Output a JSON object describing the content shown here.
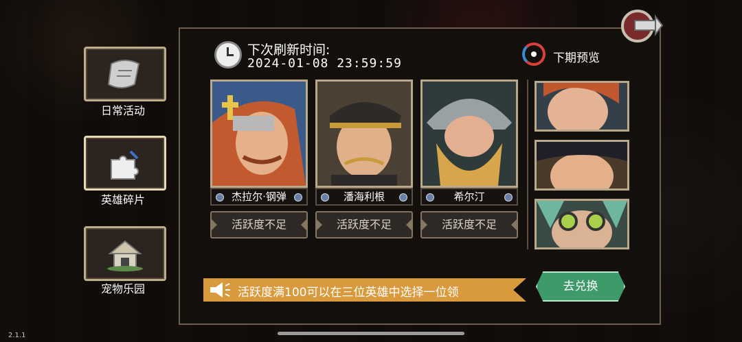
{
  "version": "2.1.1",
  "menu": [
    {
      "label": "日常活动",
      "icon": "scroll-icon"
    },
    {
      "label": "英雄碎片",
      "icon": "puzzle-piece-icon"
    },
    {
      "label": "宠物乐园",
      "icon": "pet-house-icon"
    }
  ],
  "refresh": {
    "label": "下次刷新时间:",
    "time": "2024-01-08 23:59:59"
  },
  "preview_label": "下期预览",
  "heroes": [
    {
      "name": "杰拉尔·钢弹",
      "button": "活跃度不足",
      "hair": "#c35a2f"
    },
    {
      "name": "潘海利根",
      "button": "活跃度不足",
      "hair": "#c99a3a"
    },
    {
      "name": "希尔汀",
      "button": "活跃度不足",
      "hair": "#d8a64a"
    }
  ],
  "notice": "活跃度满100可以在三位英雄中选择一位领",
  "redeem_label": "去兑换",
  "colors": {
    "accent": "#d99a3d",
    "redeem": "#3d9b6a",
    "frame": "#b9a98a"
  }
}
